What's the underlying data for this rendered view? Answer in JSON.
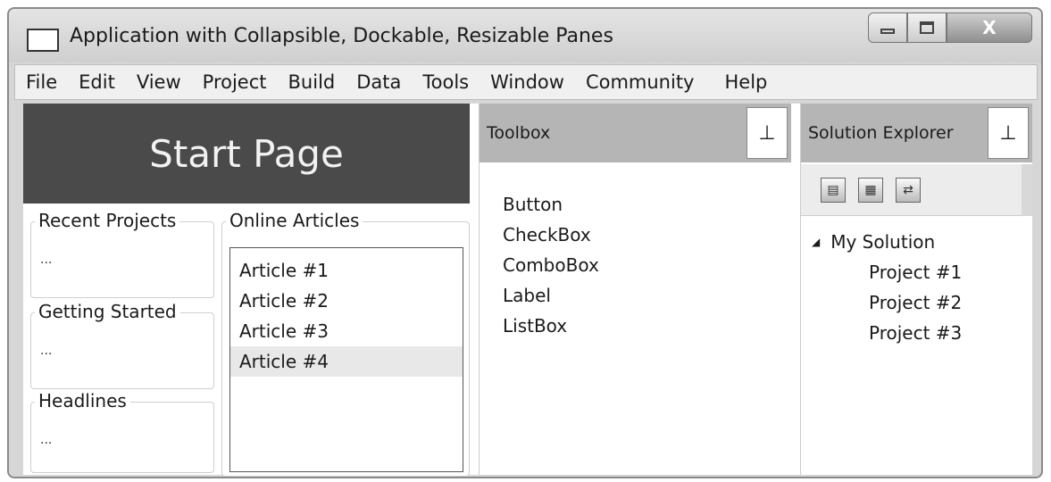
{
  "window": {
    "title": "Application with Collapsible, Dockable, Resizable Panes",
    "close_label": "X"
  },
  "menu": {
    "items": [
      "File",
      "Edit",
      "View",
      "Project",
      "Build",
      "Data",
      "Tools",
      "Window",
      "Community",
      "Help"
    ]
  },
  "start_page": {
    "title": "Start Page",
    "recent_projects": {
      "title": "Recent Projects",
      "body": "..."
    },
    "getting_started": {
      "title": "Getting Started",
      "body": "..."
    },
    "headlines": {
      "title": "Headlines",
      "body": "..."
    },
    "online_articles": {
      "title": "Online Articles",
      "items": [
        "Article #1",
        "Article #2",
        "Article #3",
        "Article #4"
      ]
    }
  },
  "toolbox": {
    "title": "Toolbox",
    "items": [
      "Button",
      "CheckBox",
      "ComboBox",
      "Label",
      "ListBox"
    ]
  },
  "solution_explorer": {
    "title": "Solution Explorer",
    "root": "My Solution",
    "projects": [
      "Project #1",
      "Project #2",
      "Project #3"
    ]
  },
  "icons": {
    "pin": "pin-icon",
    "app": "window-icon",
    "expand": "expanded-triangle-icon"
  }
}
